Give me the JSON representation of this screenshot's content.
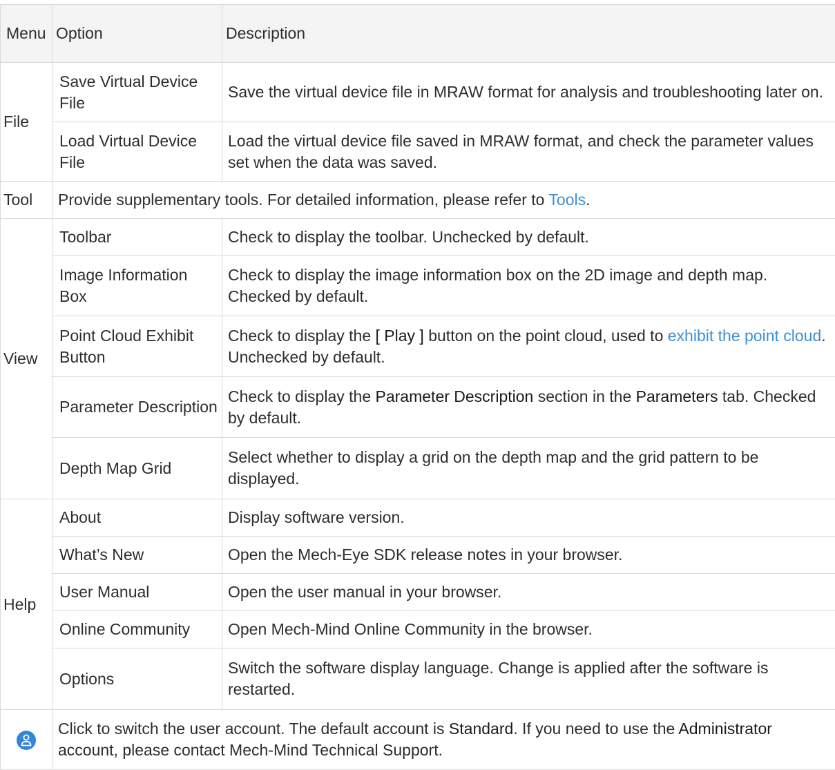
{
  "header": {
    "menu": "Menu",
    "option": "Option",
    "description": "Description"
  },
  "file": {
    "menu": "File",
    "save": {
      "option": "Save Virtual Device File",
      "description": "Save the virtual device file in MRAW format for analysis and troubleshooting later on."
    },
    "load": {
      "option": "Load Virtual Device File",
      "description": "Load the virtual device file saved in MRAW format, and check the parameter values set when the data was saved."
    }
  },
  "tool": {
    "menu": "Tool",
    "description_before": "Provide supplementary tools. For detailed information, please refer to ",
    "link": "Tools",
    "description_after": "."
  },
  "view": {
    "menu": "View",
    "toolbar": {
      "option": "Toolbar",
      "description": "Check to display the toolbar. Unchecked by default."
    },
    "image_info": {
      "option": "Image Information Box",
      "description": "Check to display the image information box on the 2D image and depth map. Checked by default."
    },
    "pc_button": {
      "option": "Point Cloud Exhibit Button",
      "d1": "Check to display the ",
      "term": "[ Play ]",
      "d2": " button on the point cloud, used to ",
      "link": "exhibit the point cloud",
      "d3": ". Unchecked by default."
    },
    "param_desc": {
      "option": "Parameter Description",
      "d1": "Check to display the ",
      "term1": "Parameter Description",
      "d2": " section in the ",
      "term2": "Parameters",
      "d3": " tab. Checked by default."
    },
    "grid": {
      "option": "Depth Map Grid",
      "description": "Select whether to display a grid on the depth map and the grid pattern to be displayed."
    }
  },
  "help": {
    "menu": "Help",
    "about": {
      "option": "About",
      "description": "Display software version."
    },
    "whats_new": {
      "option": "What’s New",
      "description": "Open the Mech-Eye SDK release notes in your browser."
    },
    "manual": {
      "option": "User Manual",
      "description": "Open the user manual in your browser."
    },
    "community": {
      "option": "Online Community",
      "description": "Open Mech-Mind Online Community in the browser."
    },
    "options": {
      "option": "Options",
      "description": "Switch the software display language. Change is applied after the software is restarted."
    }
  },
  "user": {
    "icon": "user-account-icon",
    "d1": "Click to switch the user account. The default account is ",
    "term1": "Standard",
    "d2": ". If you need to use the ",
    "term2": "Administrator",
    "d3": " account, please contact Mech-Mind Technical Support."
  },
  "colors": {
    "link": "#3d8fd6",
    "header_bg": "#f4f4f4",
    "border": "#d9d9d9",
    "icon_bg": "#2f86dc"
  }
}
